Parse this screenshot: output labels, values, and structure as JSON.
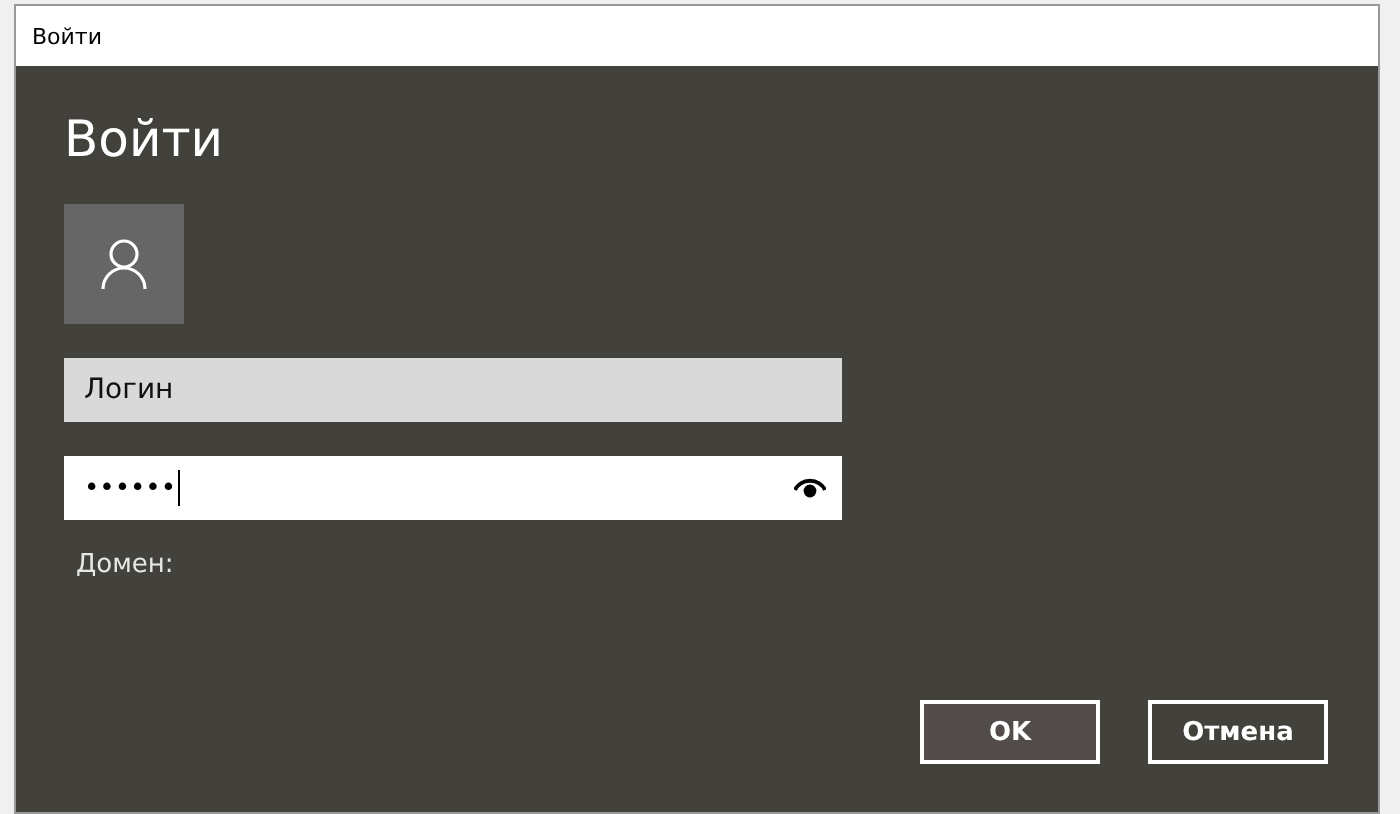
{
  "window": {
    "title": "Войти"
  },
  "heading": "Войти",
  "login_field": {
    "placeholder": "Логин"
  },
  "password_field": {
    "value": "••••••",
    "focused": true
  },
  "domain_label": "Домен:",
  "buttons": [
    {
      "label": "OK",
      "selected": true
    },
    {
      "label": "Отмена",
      "selected": false
    }
  ]
}
